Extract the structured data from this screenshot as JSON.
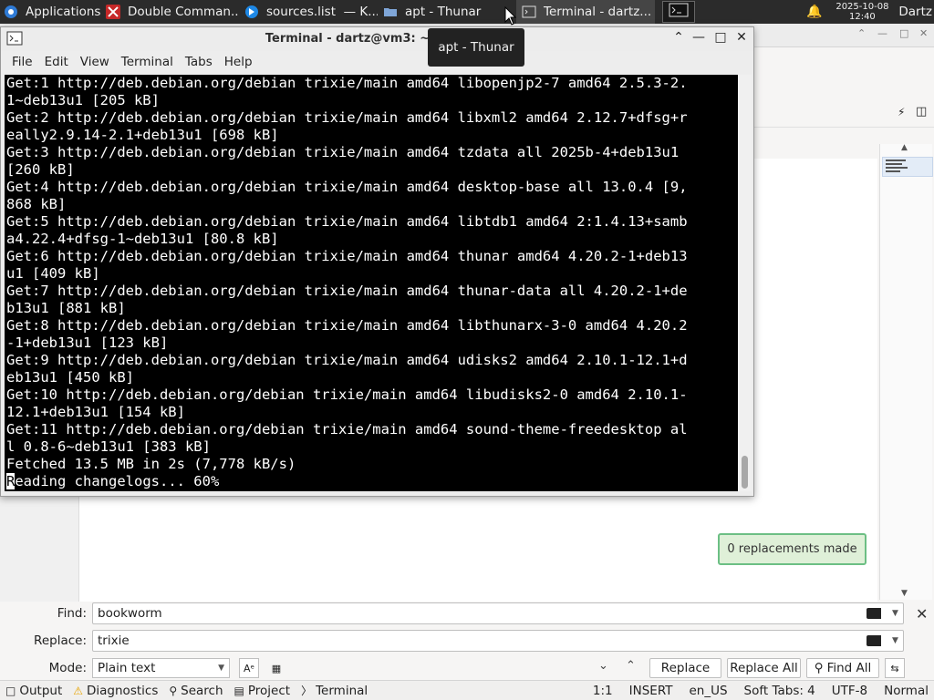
{
  "panel": {
    "applications_label": "Applications",
    "tasks": [
      {
        "label": "Double Comman..."
      },
      {
        "label": "sources.list  — K..."
      },
      {
        "label": "apt - Thunar"
      },
      {
        "label": "Terminal - dartz..."
      }
    ],
    "date": "2025-10-08",
    "time": "12:40",
    "user": "Dartz",
    "icons": [
      "xfce-logo-icon",
      "double-commander-icon",
      "kate-icon",
      "folder-icon",
      "terminal-icon",
      "notification-bell-icon"
    ]
  },
  "tooltip": "apt - Thunar",
  "terminal": {
    "title": "Terminal - dartz@vm3: ~",
    "menu": [
      "File",
      "Edit",
      "View",
      "Terminal",
      "Tabs",
      "Help"
    ],
    "lines": [
      "Get:1 http://deb.debian.org/debian trixie/main amd64 libopenjp2-7 amd64 2.5.3-2.",
      "1~deb13u1 [205 kB]",
      "Get:2 http://deb.debian.org/debian trixie/main amd64 libxml2 amd64 2.12.7+dfsg+r",
      "eally2.9.14-2.1+deb13u1 [698 kB]",
      "Get:3 http://deb.debian.org/debian trixie/main amd64 tzdata all 2025b-4+deb13u1",
      "[260 kB]",
      "Get:4 http://deb.debian.org/debian trixie/main amd64 desktop-base all 13.0.4 [9,",
      "868 kB]",
      "Get:5 http://deb.debian.org/debian trixie/main amd64 libtdb1 amd64 2:1.4.13+samb",
      "a4.22.4+dfsg-1~deb13u1 [80.8 kB]",
      "Get:6 http://deb.debian.org/debian trixie/main amd64 thunar amd64 4.20.2-1+deb13",
      "u1 [409 kB]",
      "Get:7 http://deb.debian.org/debian trixie/main amd64 thunar-data all 4.20.2-1+de",
      "b13u1 [881 kB]",
      "Get:8 http://deb.debian.org/debian trixie/main amd64 libthunarx-3-0 amd64 4.20.2",
      "-1+deb13u1 [123 kB]",
      "Get:9 http://deb.debian.org/debian trixie/main amd64 udisks2 amd64 2.10.1-12.1+d",
      "eb13u1 [450 kB]",
      "Get:10 http://deb.debian.org/debian trixie/main amd64 libudisks2-0 amd64 2.10.1-",
      "12.1+deb13u1 [154 kB]",
      "Get:11 http://deb.debian.org/debian trixie/main amd64 sound-theme-freedesktop al",
      "l 0.8-6~deb13u1 [383 kB]",
      "Fetched 13.5 MB in 2s (7,778 kB/s)"
    ],
    "last_line_cursor": "R",
    "last_line_rest": "eading changelogs... 60%"
  },
  "editor": {
    "toast": "0 replacements made",
    "find_label": "Find:",
    "find_value": "bookworm",
    "replace_label": "Replace:",
    "replace_value": "trixie",
    "mode_label": "Mode:",
    "mode_value": "Plain text",
    "buttons": {
      "replace": "Replace",
      "replace_all": "Replace All",
      "find_all": "Find All"
    }
  },
  "statusbar": {
    "left": [
      {
        "label": "Output",
        "icon": "output-icon"
      },
      {
        "label": "Diagnostics",
        "icon": "warning-icon"
      },
      {
        "label": "Search",
        "icon": "search-icon"
      },
      {
        "label": "Project",
        "icon": "project-icon"
      },
      {
        "label": "Terminal",
        "icon": "terminal-icon"
      }
    ],
    "right": [
      "1:1",
      "INSERT",
      "en_US",
      "Soft Tabs: 4",
      "UTF-8",
      "Normal"
    ]
  }
}
